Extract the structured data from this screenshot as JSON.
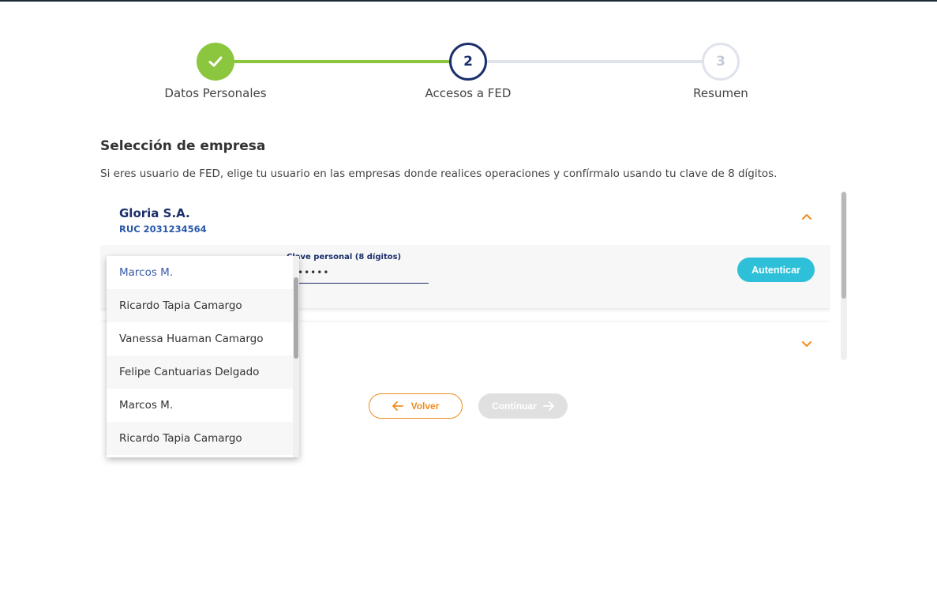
{
  "stepper": {
    "steps": [
      {
        "label": "Datos Personales",
        "status": "done"
      },
      {
        "label": "Accesos a FED",
        "number": "2",
        "status": "active"
      },
      {
        "label": "Resumen",
        "number": "3",
        "status": "pending"
      }
    ]
  },
  "section": {
    "title": "Selección de empresa",
    "description": "Si eres usuario de FED, elige tu usuario en las empresas donde realices operaciones y confírmalo usando tu clave de 8 dígitos."
  },
  "company_card": {
    "name": "Gloria S.A.",
    "ruc": "RUC 2031234564",
    "password_label": "Clave personal (8 dígitos)",
    "password_value": "•••••",
    "authenticate_label": "Autenticar"
  },
  "user_dropdown": {
    "options": [
      "Marcos M.",
      "Ricardo Tapia Camargo",
      "Vanessa Huaman Camargo",
      "Felipe Cantuarias Delgado",
      "Marcos M.",
      "Ricardo Tapia Camargo"
    ],
    "selected_index": 0
  },
  "actions": {
    "back_label": "Volver",
    "continue_label": "Continuar"
  },
  "colors": {
    "step_done": "#8cc63f",
    "step_active": "#1b2f6b",
    "accent_orange": "#f08c1e",
    "authenticate_button": "#2ec0d8",
    "disabled_button": "#e0e0e0"
  }
}
